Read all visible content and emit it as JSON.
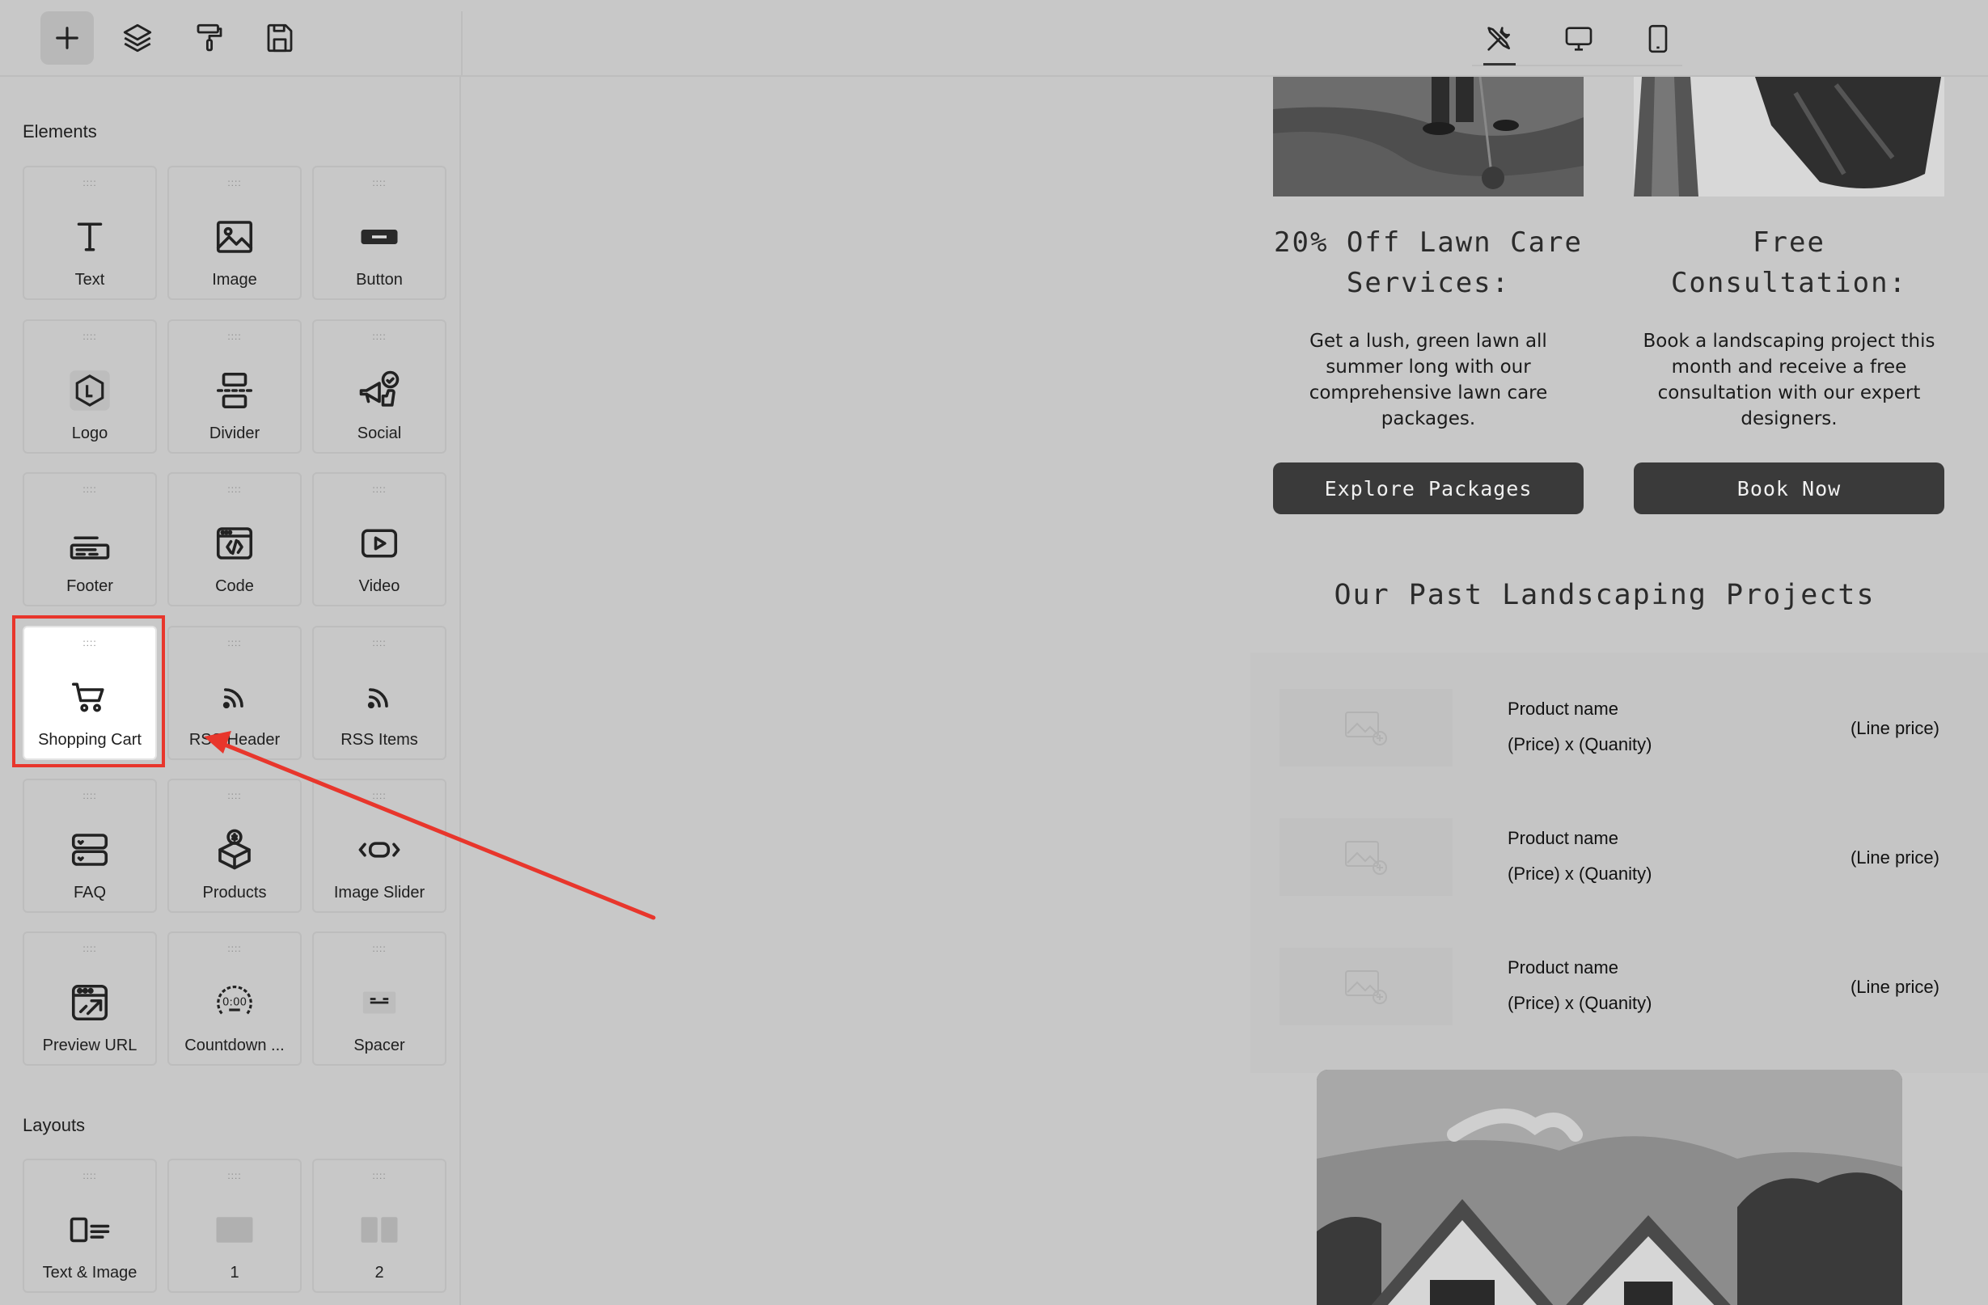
{
  "toolbar": {
    "buttons": [
      {
        "name": "add",
        "icon": "plus-icon"
      },
      {
        "name": "layers",
        "icon": "layers-icon"
      },
      {
        "name": "styles",
        "icon": "paint-roller-icon"
      },
      {
        "name": "save",
        "icon": "save-icon"
      }
    ],
    "devices": [
      {
        "name": "builder",
        "icon": "tools-icon",
        "active": true
      },
      {
        "name": "desktop",
        "icon": "monitor-icon"
      },
      {
        "name": "mobile",
        "icon": "phone-icon"
      }
    ]
  },
  "panel": {
    "elements_title": "Elements",
    "layouts_title": "Layouts",
    "elements": [
      {
        "label": "Text",
        "icon": "text-icon"
      },
      {
        "label": "Image",
        "icon": "image-icon"
      },
      {
        "label": "Button",
        "icon": "button-icon"
      },
      {
        "label": "Logo",
        "icon": "logo-icon"
      },
      {
        "label": "Divider",
        "icon": "divider-icon"
      },
      {
        "label": "Social",
        "icon": "social-icon"
      },
      {
        "label": "Footer",
        "icon": "footer-icon"
      },
      {
        "label": "Code",
        "icon": "code-icon"
      },
      {
        "label": "Video",
        "icon": "video-icon"
      },
      {
        "label": "Shopping Cart",
        "icon": "shopping-cart-icon",
        "selected": true
      },
      {
        "label": "RSS Header",
        "icon": "rss-icon"
      },
      {
        "label": "RSS Items",
        "icon": "rss-icon"
      },
      {
        "label": "FAQ",
        "icon": "faq-icon"
      },
      {
        "label": "Products",
        "icon": "products-icon"
      },
      {
        "label": "Image Slider",
        "icon": "image-slider-icon"
      },
      {
        "label": "Preview URL",
        "icon": "preview-url-icon"
      },
      {
        "label": "Countdown ...",
        "icon": "countdown-icon"
      },
      {
        "label": "Spacer",
        "icon": "spacer-icon"
      }
    ],
    "layouts": [
      {
        "label": "Text & Image",
        "icon": "text-image-layout-icon"
      },
      {
        "label": "1",
        "icon": "one-column-layout-icon"
      },
      {
        "label": "2",
        "icon": "two-column-layout-icon"
      }
    ]
  },
  "email": {
    "offers": [
      {
        "heading": "20% Off Lawn Care Services:",
        "body": "Get a lush, green lawn all summer long with our comprehensive lawn care packages.",
        "button": "Explore Packages"
      },
      {
        "heading": "Free Consultation:",
        "body": "Book a landscaping project this month and receive a free consultation with our expert designers.",
        "button": "Book Now"
      }
    ],
    "projects_heading": "Our Past Landscaping Projects",
    "cart_items": [
      {
        "name": "Product name",
        "qty": "(Price) x (Quanity)",
        "price": "(Line price)"
      },
      {
        "name": "Product name",
        "qty": "(Price) x (Quanity)",
        "price": "(Line price)"
      },
      {
        "name": "Product name",
        "qty": "(Price) x (Quanity)",
        "price": "(Line price)"
      }
    ]
  },
  "colors": {
    "highlight": "#e8362c",
    "button_bg": "#3a3a3a",
    "canvas_bg": "#c8c8c8"
  }
}
